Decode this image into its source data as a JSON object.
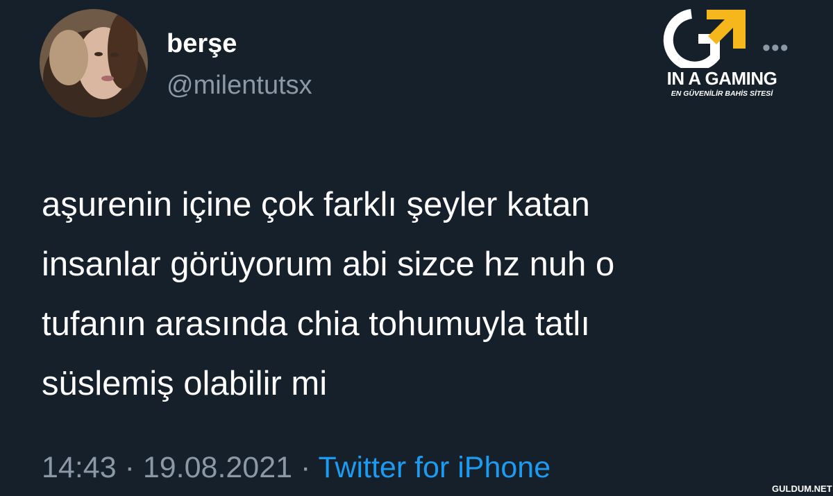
{
  "tweet": {
    "display_name": "berşe",
    "handle": "@milentutsx",
    "more_label": "•••",
    "text_lines": [
      "aşurenin içine çok farklı şeyler katan",
      "insanlar görüyorum abi sizce hz nuh o",
      "tufanın arasında chia tohumuyla tatlı",
      "süslemiş olabilir mi"
    ],
    "time": "14:43",
    "separator": "·",
    "date": "19.08.2021",
    "source": "Twitter for iPhone"
  },
  "logo": {
    "title": "IN A GAMING",
    "subtitle": "EN GÜVENİLİR BAHİS SİTESİ"
  },
  "watermark": "GULDUM.NET",
  "colors": {
    "background": "#15202b",
    "text": "#ffffff",
    "secondary": "#8b98a5",
    "link": "#1d9bf0",
    "logo_accent": "#f5b71b"
  }
}
